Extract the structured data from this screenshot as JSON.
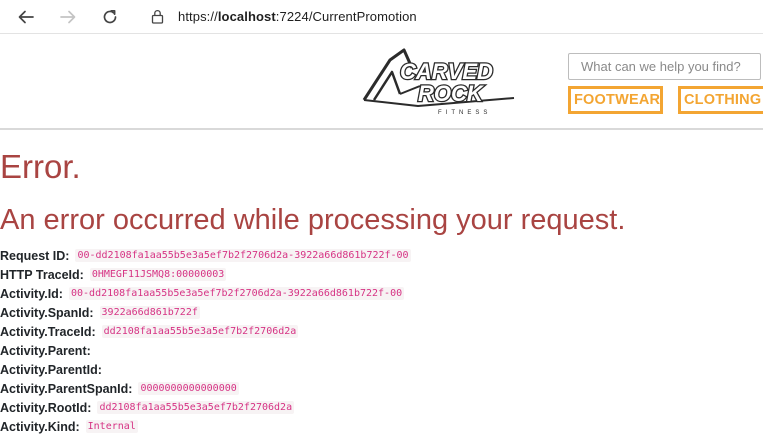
{
  "browser": {
    "url_prefix": "https://",
    "url_host": "localhost",
    "url_rest": ":7224/CurrentPromotion"
  },
  "header": {
    "logo_alt": "Carved Rock Fitness",
    "logo_line1": "CARVED",
    "logo_line2": "ROCK",
    "logo_line3": "FITNESS",
    "search_placeholder": "What can we help you find?",
    "categories": [
      {
        "label": "FOOTWEAR"
      },
      {
        "label": "CLOTHING"
      }
    ],
    "accent_color": "#f3a532"
  },
  "error": {
    "title": "Error.",
    "subtitle": "An error occurred while processing your request.",
    "color": "#a94442"
  },
  "details": [
    {
      "label": "Request ID:",
      "value": "00-dd2108fa1aa55b5e3a5ef7b2f2706d2a-3922a66d861b722f-00"
    },
    {
      "label": "HTTP TraceId:",
      "value": "0HMEGF11JSMQ8:00000003"
    },
    {
      "label": "Activity.Id:",
      "value": "00-dd2108fa1aa55b5e3a5ef7b2f2706d2a-3922a66d861b722f-00"
    },
    {
      "label": "Activity.SpanId:",
      "value": "3922a66d861b722f"
    },
    {
      "label": "Activity.TraceId:",
      "value": "dd2108fa1aa55b5e3a5ef7b2f2706d2a"
    },
    {
      "label": "Activity.Parent:",
      "value": ""
    },
    {
      "label": "Activity.ParentId:",
      "value": ""
    },
    {
      "label": "Activity.ParentSpanId:",
      "value": "0000000000000000"
    },
    {
      "label": "Activity.RootId:",
      "value": "dd2108fa1aa55b5e3a5ef7b2f2706d2a"
    },
    {
      "label": "Activity.Kind:",
      "value": "Internal"
    }
  ]
}
